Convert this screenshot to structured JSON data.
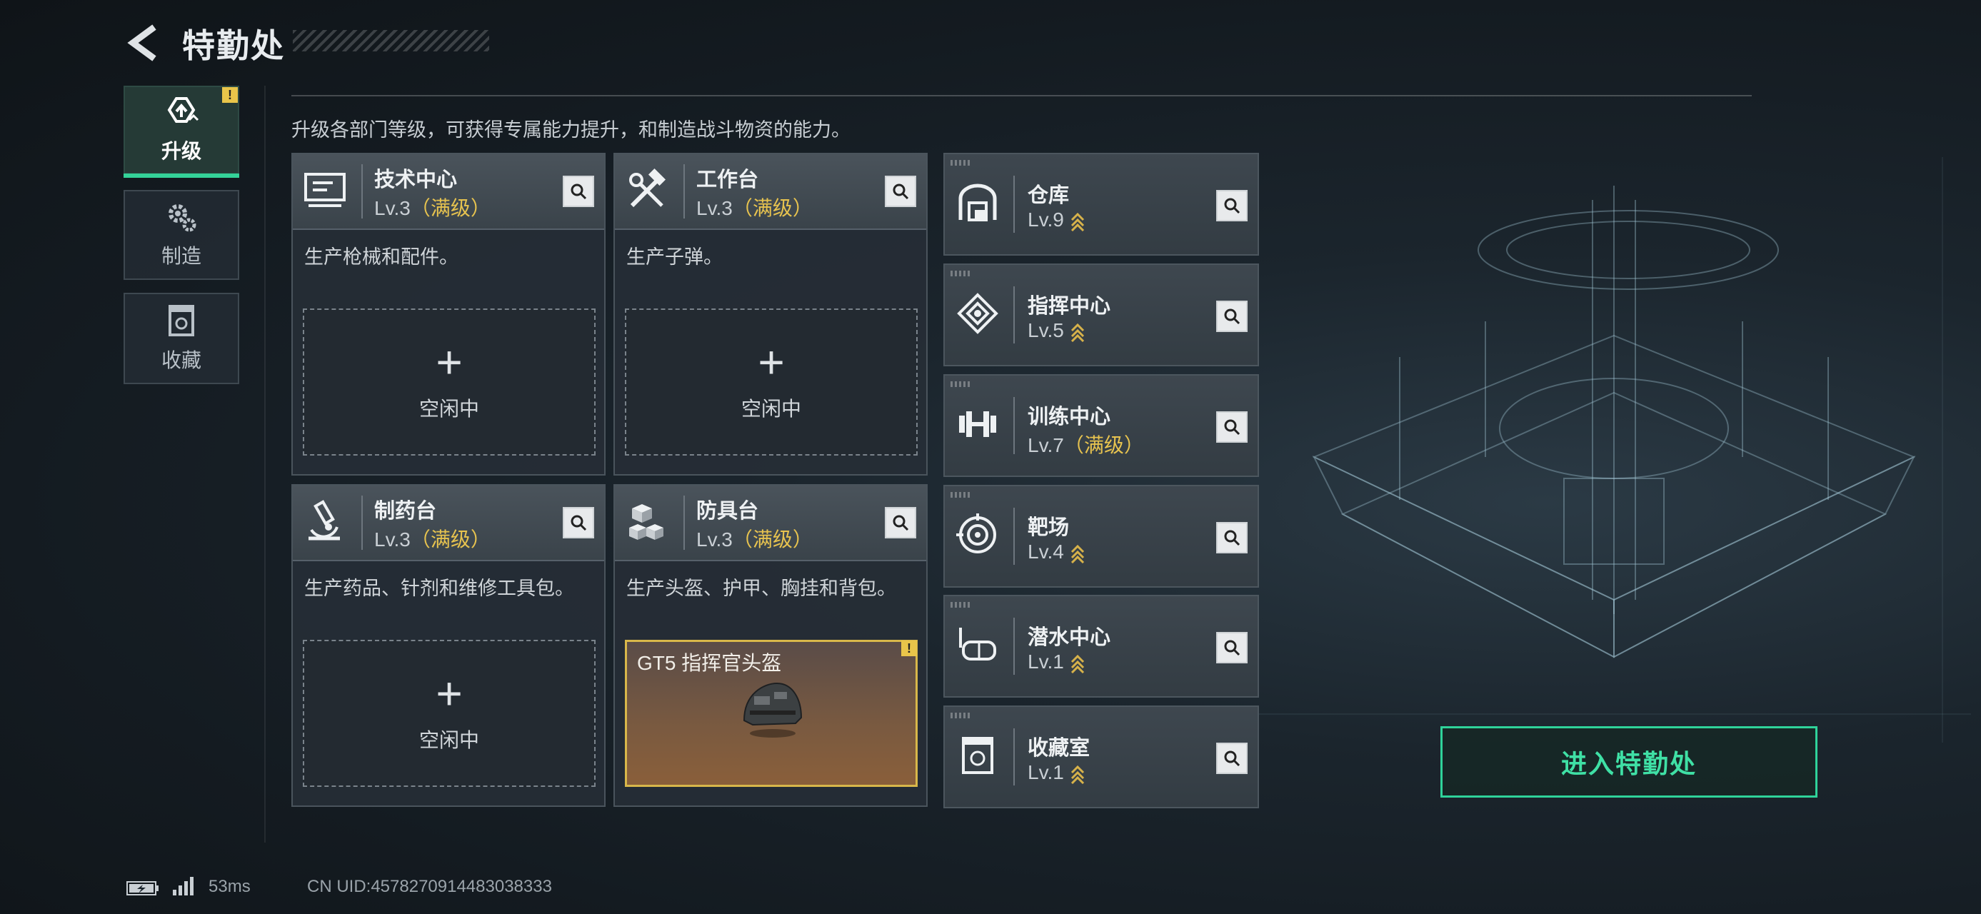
{
  "header": {
    "title": "特勤处"
  },
  "tabs": [
    {
      "label": "升级",
      "icon": "upgrade-icon",
      "active": true,
      "alert": "!"
    },
    {
      "label": "制造",
      "icon": "gears-icon",
      "active": false
    },
    {
      "label": "收藏",
      "icon": "collection-icon",
      "active": false
    }
  ],
  "subtitle": "升级各部门等级，可获得专属能力提升，和制造战斗物资的能力。",
  "cards": [
    {
      "name": "技术中心",
      "level": "Lv.3",
      "max": "（满级）",
      "desc": "生产枪械和配件。",
      "idle_plus": "+",
      "idle": "空闲中"
    },
    {
      "name": "工作台",
      "level": "Lv.3",
      "max": "（满级）",
      "desc": "生产子弹。",
      "idle_plus": "+",
      "idle": "空闲中"
    },
    {
      "name": "制药台",
      "level": "Lv.3",
      "max": "（满级）",
      "desc": "生产药品、针剂和维修工具包。",
      "idle_plus": "+",
      "idle": "空闲中"
    },
    {
      "name": "防具台",
      "level": "Lv.3",
      "max": "（满级）",
      "desc": "生产头盔、护甲、胸挂和背包。",
      "product": "GT5 指挥官头盔",
      "product_alert": "!"
    }
  ],
  "facilities": [
    {
      "name": "仓库",
      "level": "Lv.9",
      "max": "",
      "upgradable": true
    },
    {
      "name": "指挥中心",
      "level": "Lv.5",
      "max": "",
      "upgradable": true
    },
    {
      "name": "训练中心",
      "level": "Lv.7",
      "max": "（满级）",
      "upgradable": false
    },
    {
      "name": "靶场",
      "level": "Lv.4",
      "max": "",
      "upgradable": true
    },
    {
      "name": "潜水中心",
      "level": "Lv.1",
      "max": "",
      "upgradable": true
    },
    {
      "name": "收藏室",
      "level": "Lv.1",
      "max": "",
      "upgradable": true
    }
  ],
  "enter_button": "进入特勤处",
  "footer": {
    "ping": "53ms",
    "uid": "CN UID:4578270914483038333"
  },
  "colors": {
    "accent": "#34d399",
    "max_level": "#e7c34f",
    "warning": "#e9c54a"
  }
}
